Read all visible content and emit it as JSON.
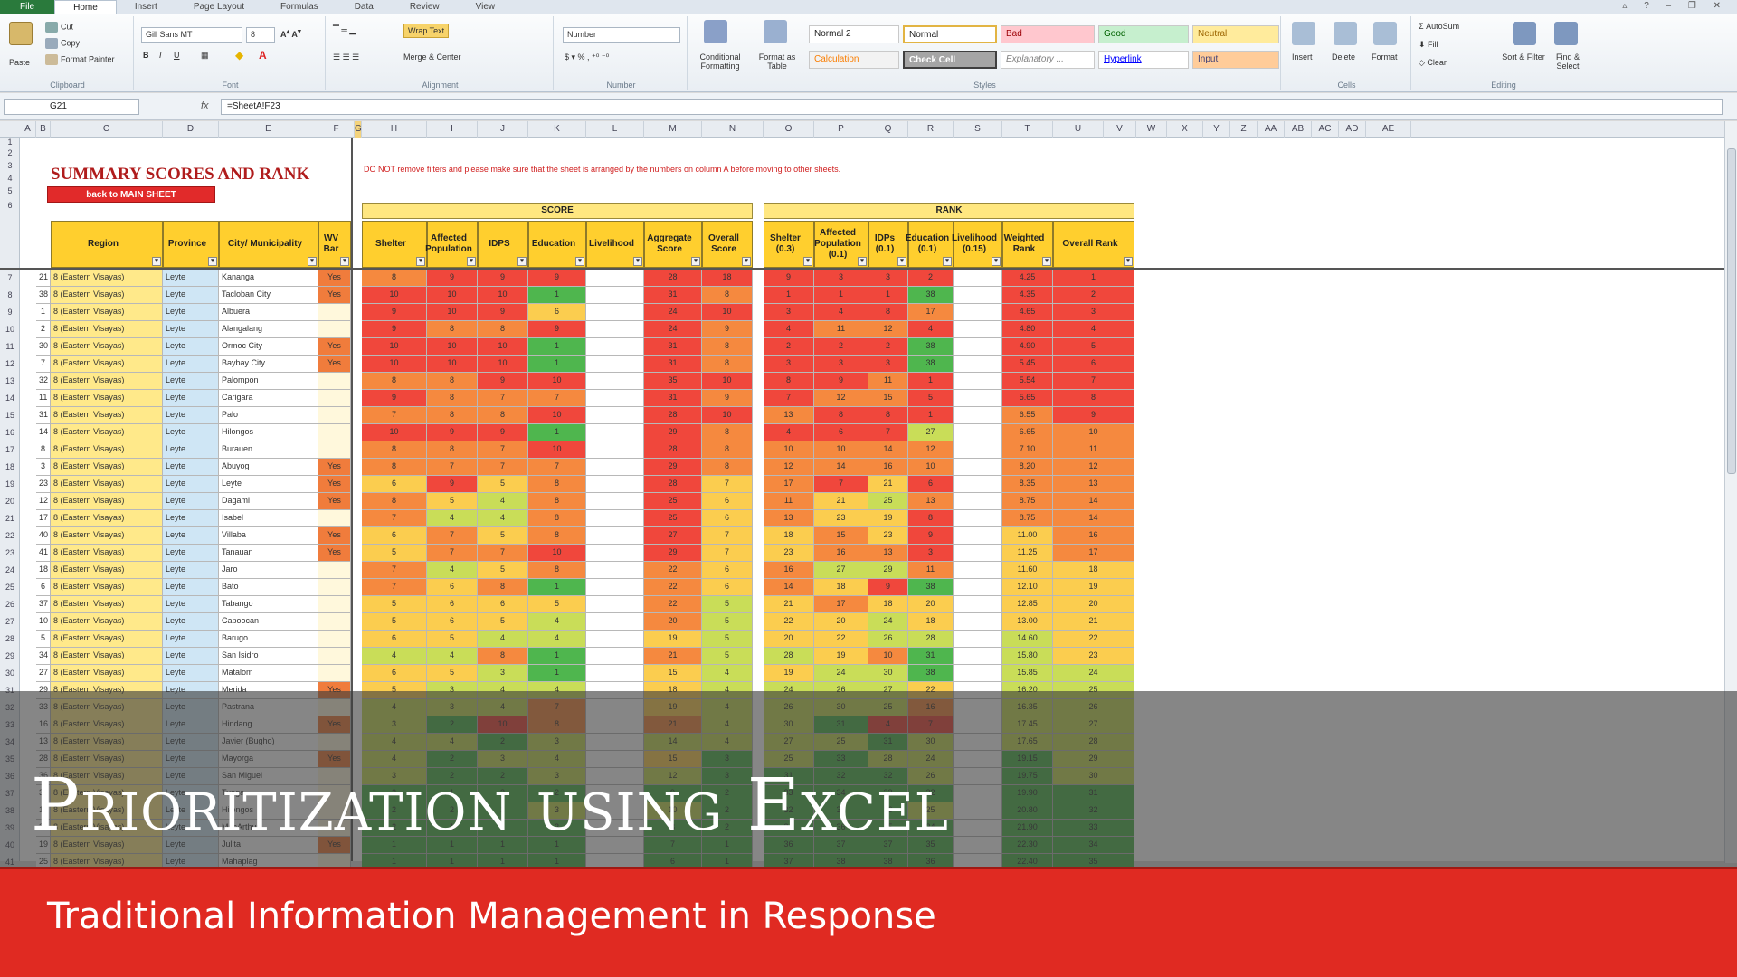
{
  "app": {
    "tabs": [
      "File",
      "Home",
      "Insert",
      "Page Layout",
      "Formulas",
      "Data",
      "Review",
      "View"
    ],
    "active_tab": "Home"
  },
  "ribbon": {
    "clipboard": {
      "paste": "Paste",
      "cut": "Cut",
      "copy": "Copy",
      "format_painter": "Format Painter",
      "label": "Clipboard"
    },
    "font": {
      "family": "Gill Sans MT",
      "size": "8",
      "label": "Font"
    },
    "alignment": {
      "wrap_text": "Wrap Text",
      "merge_center": "Merge & Center",
      "label": "Alignment"
    },
    "number": {
      "format": "Number",
      "label": "Number"
    },
    "styles_group": {
      "conditional": "Conditional Formatting",
      "format_table": "Format as Table",
      "label": "Styles"
    },
    "styles": [
      "Normal 2",
      "Normal",
      "Bad",
      "Good",
      "Neutral",
      "Calculation",
      "Check Cell",
      "Explanatory ...",
      "Hyperlink",
      "Input"
    ],
    "cells": {
      "insert": "Insert",
      "delete": "Delete",
      "format": "Format",
      "label": "Cells"
    },
    "editing": {
      "autosum": "AutoSum",
      "fill": "Fill",
      "clear": "Clear",
      "sort_filter": "Sort & Filter",
      "find_select": "Find & Select",
      "label": "Editing"
    }
  },
  "formula_bar": {
    "name_box": "G21",
    "fx": "fx",
    "formula": "=SheetA!F23"
  },
  "columns": [
    "A",
    "B",
    "C",
    "D",
    "E",
    "F",
    "G",
    "H",
    "I",
    "J",
    "K",
    "L",
    "M",
    "N",
    "O",
    "P",
    "Q",
    "R",
    "S",
    "T",
    "U",
    "V",
    "W",
    "X",
    "Y",
    "Z",
    "AA",
    "AB",
    "AC",
    "AD",
    "AE"
  ],
  "sheet": {
    "title": "SUMMARY SCORES AND RANK",
    "back_button": "back to MAIN SHEET",
    "note": "DO NOT remove filters and please make sure that the sheet is arranged by the numbers on column A before moving to other sheets.",
    "score_band": "SCORE",
    "rank_band": "RANK",
    "headers_left": [
      "Region",
      "Province",
      "City/ Municipality",
      "WV Bar"
    ],
    "headers_score": [
      "Shelter",
      "Affected Population",
      "IDPS",
      "Education",
      "Livelihood",
      "Aggregate Score",
      "Overall Score"
    ],
    "headers_rank": [
      "Shelter (0.3)",
      "Affected Population (0.1)",
      "IDPs (0.1)",
      "Education (0.1)",
      "Livelihood (0.15)",
      "Weighted Rank",
      "Overall Rank"
    ],
    "row_numbers": [
      "1",
      "2",
      "3",
      "4",
      "5",
      "6",
      "7",
      "8",
      "9",
      "10",
      "11",
      "12",
      "13",
      "14",
      "15",
      "16",
      "17",
      "18",
      "19",
      "20",
      "21",
      "22",
      "23",
      "24",
      "25",
      "26",
      "27",
      "28",
      "29",
      "30",
      "31",
      "32",
      "33",
      "34",
      "35",
      "36",
      "37",
      "38",
      "39",
      "40",
      "41"
    ],
    "rows": [
      {
        "a": "21",
        "region": "8 (Eastern Visayas)",
        "prov": "Leyte",
        "city": "Kananga",
        "wv": "Yes",
        "s": [
          "8",
          "9",
          "9",
          "9",
          "",
          "28",
          "18"
        ],
        "r": [
          "9",
          "3",
          "3",
          "2",
          "",
          "4.25",
          "1"
        ]
      },
      {
        "a": "38",
        "region": "8 (Eastern Visayas)",
        "prov": "Leyte",
        "city": "Tacloban City",
        "wv": "Yes",
        "s": [
          "10",
          "10",
          "10",
          "1",
          "",
          "31",
          "8"
        ],
        "r": [
          "1",
          "1",
          "1",
          "38",
          "",
          "4.35",
          "2"
        ]
      },
      {
        "a": "1",
        "region": "8 (Eastern Visayas)",
        "prov": "Leyte",
        "city": "Albuera",
        "wv": "",
        "s": [
          "9",
          "10",
          "9",
          "6",
          "",
          "24",
          "10"
        ],
        "r": [
          "3",
          "4",
          "8",
          "17",
          "",
          "4.65",
          "3"
        ]
      },
      {
        "a": "2",
        "region": "8 (Eastern Visayas)",
        "prov": "Leyte",
        "city": "Alangalang",
        "wv": "",
        "s": [
          "9",
          "8",
          "8",
          "9",
          "",
          "24",
          "9"
        ],
        "r": [
          "4",
          "11",
          "12",
          "4",
          "",
          "4.80",
          "4"
        ]
      },
      {
        "a": "30",
        "region": "8 (Eastern Visayas)",
        "prov": "Leyte",
        "city": "Ormoc City",
        "wv": "Yes",
        "s": [
          "10",
          "10",
          "10",
          "1",
          "",
          "31",
          "8"
        ],
        "r": [
          "2",
          "2",
          "2",
          "38",
          "",
          "4.90",
          "5"
        ]
      },
      {
        "a": "7",
        "region": "8 (Eastern Visayas)",
        "prov": "Leyte",
        "city": "Baybay City",
        "wv": "Yes",
        "s": [
          "10",
          "10",
          "10",
          "1",
          "",
          "31",
          "8"
        ],
        "r": [
          "3",
          "3",
          "3",
          "38",
          "",
          "5.45",
          "6"
        ]
      },
      {
        "a": "32",
        "region": "8 (Eastern Visayas)",
        "prov": "Leyte",
        "city": "Palompon",
        "wv": "",
        "s": [
          "8",
          "8",
          "9",
          "10",
          "",
          "35",
          "10"
        ],
        "r": [
          "8",
          "9",
          "11",
          "1",
          "",
          "5.54",
          "7"
        ]
      },
      {
        "a": "11",
        "region": "8 (Eastern Visayas)",
        "prov": "Leyte",
        "city": "Carigara",
        "wv": "",
        "s": [
          "9",
          "8",
          "7",
          "7",
          "",
          "31",
          "9"
        ],
        "r": [
          "7",
          "12",
          "15",
          "5",
          "",
          "5.65",
          "8"
        ]
      },
      {
        "a": "31",
        "region": "8 (Eastern Visayas)",
        "prov": "Leyte",
        "city": "Palo",
        "wv": "",
        "s": [
          "7",
          "8",
          "8",
          "10",
          "",
          "28",
          "10"
        ],
        "r": [
          "13",
          "8",
          "8",
          "1",
          "",
          "6.55",
          "9"
        ]
      },
      {
        "a": "14",
        "region": "8 (Eastern Visayas)",
        "prov": "Leyte",
        "city": "Hilongos",
        "wv": "",
        "s": [
          "10",
          "9",
          "9",
          "1",
          "",
          "29",
          "8"
        ],
        "r": [
          "4",
          "6",
          "7",
          "27",
          "",
          "6.65",
          "10"
        ]
      },
      {
        "a": "8",
        "region": "8 (Eastern Visayas)",
        "prov": "Leyte",
        "city": "Burauen",
        "wv": "",
        "s": [
          "8",
          "8",
          "7",
          "10",
          "",
          "28",
          "8"
        ],
        "r": [
          "10",
          "10",
          "14",
          "12",
          "",
          "7.10",
          "11"
        ]
      },
      {
        "a": "3",
        "region": "8 (Eastern Visayas)",
        "prov": "Leyte",
        "city": "Abuyog",
        "wv": "Yes",
        "s": [
          "8",
          "7",
          "7",
          "7",
          "",
          "29",
          "8"
        ],
        "r": [
          "12",
          "14",
          "16",
          "10",
          "",
          "8.20",
          "12"
        ]
      },
      {
        "a": "23",
        "region": "8 (Eastern Visayas)",
        "prov": "Leyte",
        "city": "Leyte",
        "wv": "Yes",
        "s": [
          "6",
          "9",
          "5",
          "8",
          "",
          "28",
          "7"
        ],
        "r": [
          "17",
          "7",
          "21",
          "6",
          "",
          "8.35",
          "13"
        ]
      },
      {
        "a": "12",
        "region": "8 (Eastern Visayas)",
        "prov": "Leyte",
        "city": "Dagami",
        "wv": "Yes",
        "s": [
          "8",
          "5",
          "4",
          "8",
          "",
          "25",
          "6"
        ],
        "r": [
          "11",
          "21",
          "25",
          "13",
          "",
          "8.75",
          "14"
        ]
      },
      {
        "a": "17",
        "region": "8 (Eastern Visayas)",
        "prov": "Leyte",
        "city": "Isabel",
        "wv": "",
        "s": [
          "7",
          "4",
          "4",
          "8",
          "",
          "25",
          "6"
        ],
        "r": [
          "13",
          "23",
          "19",
          "8",
          "",
          "8.75",
          "14"
        ]
      },
      {
        "a": "40",
        "region": "8 (Eastern Visayas)",
        "prov": "Leyte",
        "city": "Villaba",
        "wv": "Yes",
        "s": [
          "6",
          "7",
          "5",
          "8",
          "",
          "27",
          "7"
        ],
        "r": [
          "18",
          "15",
          "23",
          "9",
          "",
          "11.00",
          "16"
        ]
      },
      {
        "a": "41",
        "region": "8 (Eastern Visayas)",
        "prov": "Leyte",
        "city": "Tanauan",
        "wv": "Yes",
        "s": [
          "5",
          "7",
          "7",
          "10",
          "",
          "29",
          "7"
        ],
        "r": [
          "23",
          "16",
          "13",
          "3",
          "",
          "11.25",
          "17"
        ]
      },
      {
        "a": "18",
        "region": "8 (Eastern Visayas)",
        "prov": "Leyte",
        "city": "Jaro",
        "wv": "",
        "s": [
          "7",
          "4",
          "5",
          "8",
          "",
          "22",
          "6"
        ],
        "r": [
          "16",
          "27",
          "29",
          "11",
          "",
          "11.60",
          "18"
        ]
      },
      {
        "a": "6",
        "region": "8 (Eastern Visayas)",
        "prov": "Leyte",
        "city": "Bato",
        "wv": "",
        "s": [
          "7",
          "6",
          "8",
          "1",
          "",
          "22",
          "6"
        ],
        "r": [
          "14",
          "18",
          "9",
          "38",
          "",
          "12.10",
          "19"
        ]
      },
      {
        "a": "37",
        "region": "8 (Eastern Visayas)",
        "prov": "Leyte",
        "city": "Tabango",
        "wv": "",
        "s": [
          "5",
          "6",
          "6",
          "5",
          "",
          "22",
          "5"
        ],
        "r": [
          "21",
          "17",
          "18",
          "20",
          "",
          "12.85",
          "20"
        ]
      },
      {
        "a": "10",
        "region": "8 (Eastern Visayas)",
        "prov": "Leyte",
        "city": "Capoocan",
        "wv": "",
        "s": [
          "5",
          "6",
          "5",
          "4",
          "",
          "20",
          "5"
        ],
        "r": [
          "22",
          "20",
          "24",
          "18",
          "",
          "13.00",
          "21"
        ]
      },
      {
        "a": "5",
        "region": "8 (Eastern Visayas)",
        "prov": "Leyte",
        "city": "Barugo",
        "wv": "",
        "s": [
          "6",
          "5",
          "4",
          "4",
          "",
          "19",
          "5"
        ],
        "r": [
          "20",
          "22",
          "26",
          "28",
          "",
          "14.60",
          "22"
        ]
      },
      {
        "a": "34",
        "region": "8 (Eastern Visayas)",
        "prov": "Leyte",
        "city": "San Isidro",
        "wv": "",
        "s": [
          "4",
          "4",
          "8",
          "1",
          "",
          "21",
          "5"
        ],
        "r": [
          "28",
          "19",
          "10",
          "31",
          "",
          "15.80",
          "23"
        ]
      },
      {
        "a": "27",
        "region": "8 (Eastern Visayas)",
        "prov": "Leyte",
        "city": "Matalom",
        "wv": "",
        "s": [
          "6",
          "5",
          "3",
          "1",
          "",
          "15",
          "4"
        ],
        "r": [
          "19",
          "24",
          "30",
          "38",
          "",
          "15.85",
          "24"
        ]
      },
      {
        "a": "29",
        "region": "8 (Eastern Visayas)",
        "prov": "Leyte",
        "city": "Merida",
        "wv": "Yes",
        "s": [
          "5",
          "3",
          "4",
          "4",
          "",
          "18",
          "4"
        ],
        "r": [
          "24",
          "26",
          "27",
          "22",
          "",
          "16.20",
          "25"
        ]
      },
      {
        "a": "33",
        "region": "8 (Eastern Visayas)",
        "prov": "Leyte",
        "city": "Pastrana",
        "wv": "",
        "s": [
          "4",
          "3",
          "4",
          "7",
          "",
          "19",
          "4"
        ],
        "r": [
          "26",
          "30",
          "25",
          "16",
          "",
          "16.35",
          "26"
        ]
      },
      {
        "a": "16",
        "region": "8 (Eastern Visayas)",
        "prov": "Leyte",
        "city": "Hindang",
        "wv": "Yes",
        "s": [
          "3",
          "2",
          "10",
          "8",
          "",
          "21",
          "4"
        ],
        "r": [
          "30",
          "31",
          "4",
          "7",
          "",
          "17.45",
          "27"
        ]
      },
      {
        "a": "13",
        "region": "8 (Eastern Visayas)",
        "prov": "Leyte",
        "city": "Javier (Bugho)",
        "wv": "",
        "s": [
          "4",
          "4",
          "2",
          "3",
          "",
          "14",
          "4"
        ],
        "r": [
          "27",
          "25",
          "31",
          "30",
          "",
          "17.65",
          "28"
        ]
      },
      {
        "a": "28",
        "region": "8 (Eastern Visayas)",
        "prov": "Leyte",
        "city": "Mayorga",
        "wv": "Yes",
        "s": [
          "4",
          "2",
          "3",
          "4",
          "",
          "15",
          "3"
        ],
        "r": [
          "25",
          "33",
          "28",
          "24",
          "",
          "19.15",
          "29"
        ]
      },
      {
        "a": "36",
        "region": "8 (Eastern Visayas)",
        "prov": "Leyte",
        "city": "San Miguel",
        "wv": "",
        "s": [
          "3",
          "2",
          "2",
          "3",
          "",
          "12",
          "3"
        ],
        "r": [
          "31",
          "32",
          "32",
          "26",
          "",
          "19.75",
          "30"
        ]
      },
      {
        "a": "39",
        "region": "8 (Eastern Visayas)",
        "prov": "Leyte",
        "city": "Tunga",
        "wv": "",
        "s": [
          "2",
          "1",
          "2",
          "2",
          "",
          "9",
          "2"
        ],
        "r": [
          "33",
          "34",
          "33",
          "32",
          "",
          "19.90",
          "31"
        ]
      },
      {
        "a": "15",
        "region": "8 (Eastern Visayas)",
        "prov": "Leyte",
        "city": "Hilongos",
        "wv": "",
        "s": [
          "2",
          "2",
          "1",
          "3",
          "",
          "10",
          "2"
        ],
        "r": [
          "32",
          "35",
          "36",
          "25",
          "",
          "20.80",
          "32"
        ]
      },
      {
        "a": "24",
        "region": "8 (Eastern Visayas)",
        "prov": "Leyte",
        "city": "MacArthur",
        "wv": "",
        "s": [
          "2",
          "1",
          "1",
          "2",
          "",
          "8",
          "2"
        ],
        "r": [
          "34",
          "36",
          "35",
          "34",
          "",
          "21.90",
          "33"
        ]
      },
      {
        "a": "19",
        "region": "8 (Eastern Visayas)",
        "prov": "Leyte",
        "city": "Julita",
        "wv": "Yes",
        "s": [
          "1",
          "1",
          "1",
          "1",
          "",
          "7",
          "1"
        ],
        "r": [
          "36",
          "37",
          "37",
          "35",
          "",
          "22.30",
          "34"
        ]
      },
      {
        "a": "25",
        "region": "8 (Eastern Visayas)",
        "prov": "Leyte",
        "city": "Mahaplag",
        "wv": "",
        "s": [
          "1",
          "1",
          "1",
          "1",
          "",
          "6",
          "1"
        ],
        "r": [
          "37",
          "38",
          "38",
          "36",
          "",
          "22.40",
          "35"
        ]
      }
    ]
  },
  "overlay": {
    "title": "Prioritization using Excel",
    "subtitle": "Traditional Information Management in Response"
  },
  "colors": {
    "red": "#e02a22",
    "header_yellow": "#ffcf2e",
    "band_yellow": "#ffe780",
    "high": "#f0473c",
    "mid_high": "#f5893f",
    "mid": "#fbcd4f",
    "mid_low": "#c9dd58",
    "low": "#4fb64e"
  }
}
